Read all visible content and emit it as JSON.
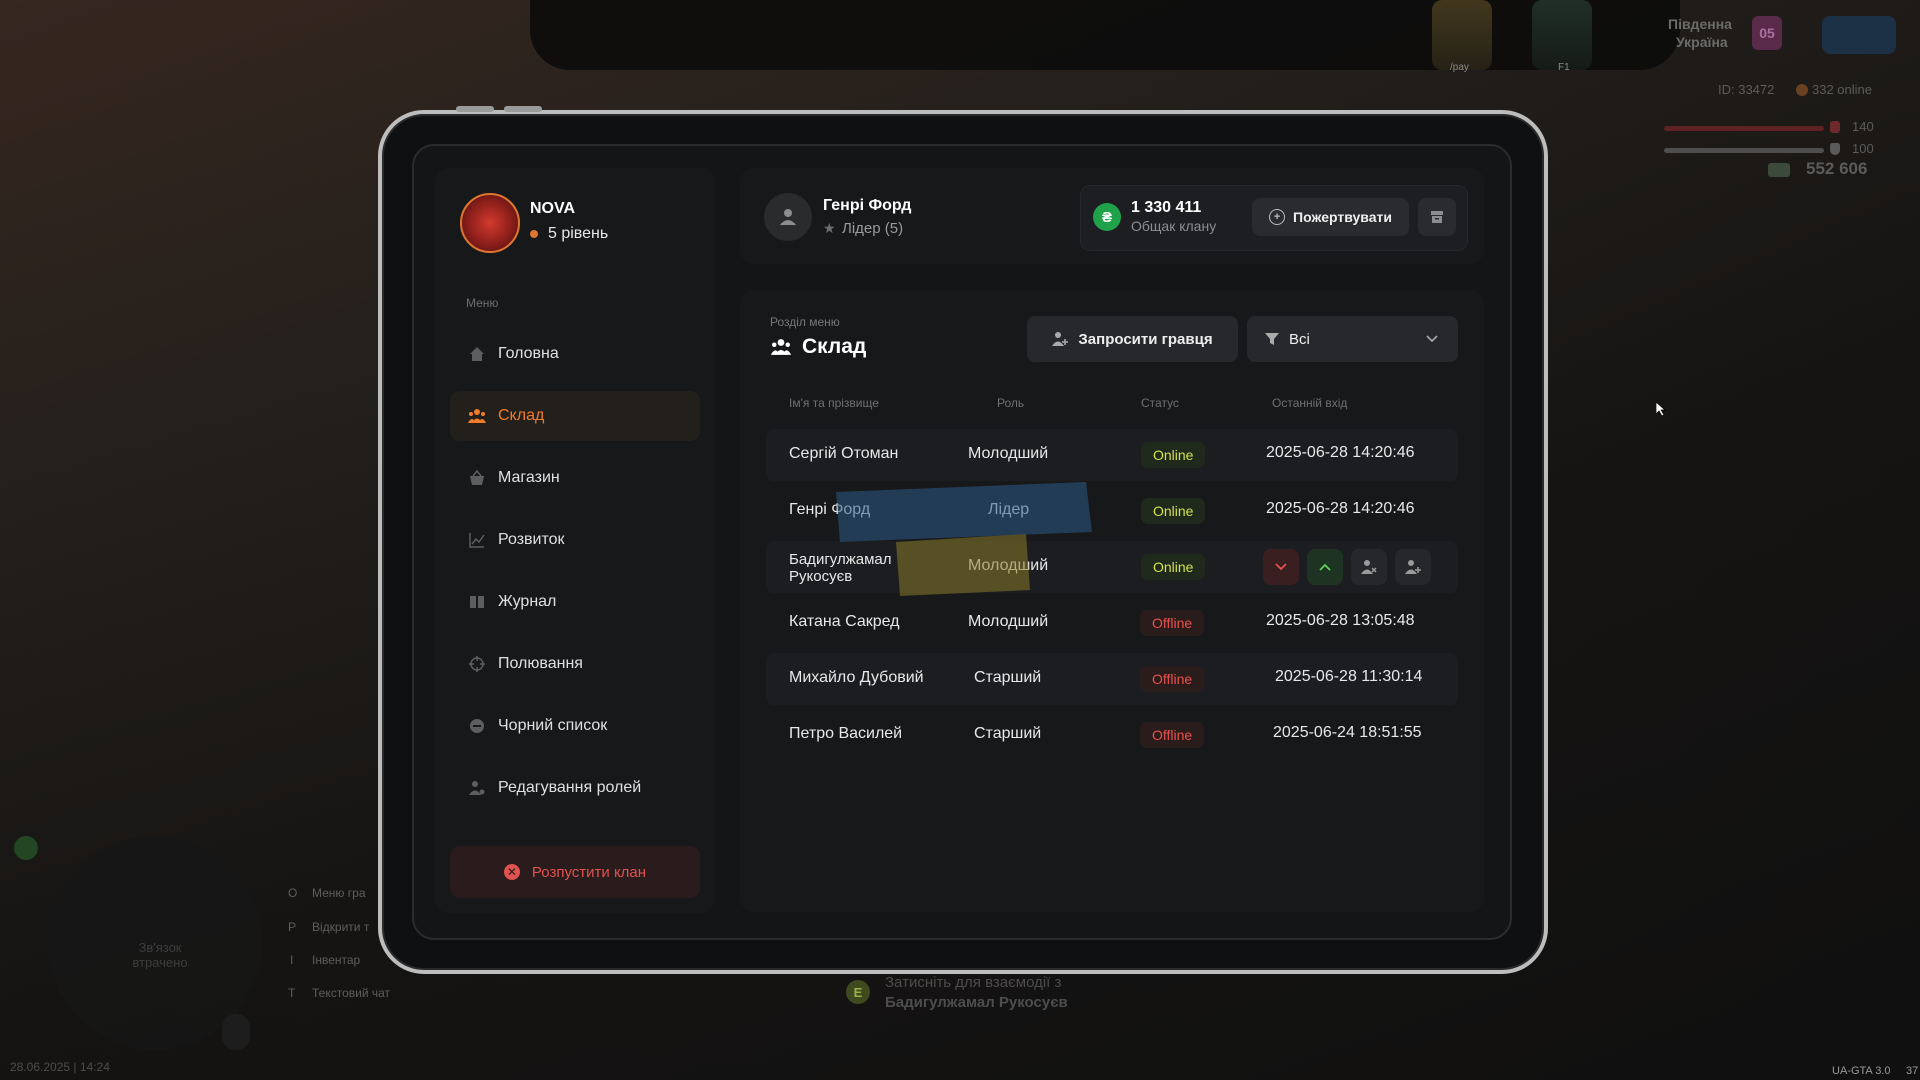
{
  "hud": {
    "region_line1": "Південна",
    "region_line2": "Україна",
    "region_code": "05",
    "id_text": "ID: 33472",
    "online_text": "332 online",
    "health": "140",
    "armor": "100",
    "money": "552 606",
    "car1_label": "/pay",
    "car2_label": "F1",
    "datetime": "28.06.2025 | 14:24",
    "version": "UA-GTA 3.0",
    "version_suffix": "37",
    "radar_text": "Зв'язок втрачено",
    "keys": [
      {
        "key": "O",
        "label": "Меню гра"
      },
      {
        "key": "P",
        "label": "Відкрити т"
      },
      {
        "key": "I",
        "label": "Інвентар"
      },
      {
        "key": "T",
        "label": "Текстовий чат"
      }
    ],
    "interact_key": "E",
    "interact_line1": "Затисніть для взаємодії з",
    "interact_line2": "Бадигулжамал Рукосуєв"
  },
  "clan": {
    "name": "NOVA",
    "level": "5 рівень"
  },
  "menu": {
    "caption": "Меню",
    "items": [
      {
        "label": "Головна",
        "icon": "home-icon"
      },
      {
        "label": "Склад",
        "icon": "users-icon"
      },
      {
        "label": "Магазин",
        "icon": "basket-icon"
      },
      {
        "label": "Розвиток",
        "icon": "chart-icon"
      },
      {
        "label": "Журнал",
        "icon": "book-icon"
      },
      {
        "label": "Полювання",
        "icon": "crosshair-icon"
      },
      {
        "label": "Чорний список",
        "icon": "block-icon"
      },
      {
        "label": "Редагування ролей",
        "icon": "user-gear-icon"
      }
    ],
    "active_index": 1,
    "disband_label": "Розпустити клан"
  },
  "user": {
    "name": "Генрі Форд",
    "role": "Лідер (5)"
  },
  "bank": {
    "currency_symbol": "₴",
    "amount": "1 330 411",
    "label": "Общак клану",
    "donate_label": "Пожертвувати"
  },
  "section": {
    "caption": "Розділ меню",
    "title": "Склад",
    "invite_label": "Запросити гравця",
    "filter_value": "Всі"
  },
  "table": {
    "headers": [
      "Ім'я та прізвище",
      "Роль",
      "Статус",
      "Останній вхід"
    ],
    "rows": [
      {
        "name_line1": "Сергій Отоман",
        "name_line2": "",
        "role": "Молодший",
        "status": "Online",
        "last": "2025-06-28 14:20:46"
      },
      {
        "name_line1": "Генрі Форд",
        "name_line2": "",
        "role": "Лідер",
        "status": "Online",
        "last": "2025-06-28 14:20:46"
      },
      {
        "name_line1": "Бадигулжамал",
        "name_line2": "Рукосуєв",
        "role": "Молодший",
        "status": "Online",
        "last": ""
      },
      {
        "name_line1": "Катана Сакред",
        "name_line2": "",
        "role": "Молодший",
        "status": "Offline",
        "last": "2025-06-28 13:05:48"
      },
      {
        "name_line1": "Михайло Дубовий",
        "name_line2": "",
        "role": "Старший",
        "status": "Offline",
        "last": "2025-06-28 11:30:14"
      },
      {
        "name_line1": "Петро Василей",
        "name_line2": "",
        "role": "Старший",
        "status": "Offline",
        "last": "2025-06-24 18:51:55"
      }
    ]
  },
  "colors": {
    "accent": "#f07c2a",
    "online": "#d6e04a",
    "offline": "#e6534f",
    "money_green": "#1fa24a"
  }
}
